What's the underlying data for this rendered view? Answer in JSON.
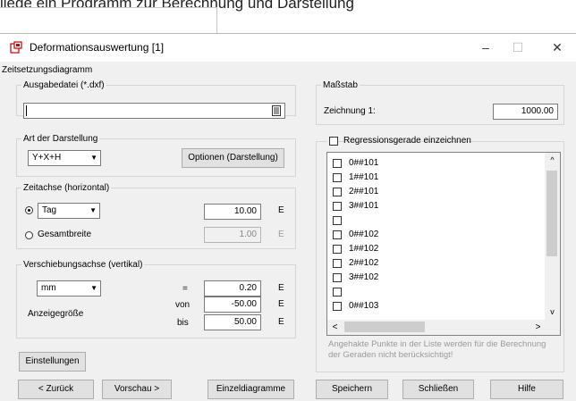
{
  "background": {
    "header_text": "liege ein Programm zur Berechnung und Darstellung"
  },
  "window": {
    "title": "Deformationsauswertung [1]",
    "controls": {
      "minimize": "–",
      "maximize": "☐",
      "close": "✕"
    },
    "subtitle": "Zeitsetzungsdiagramm"
  },
  "ausgabe": {
    "legend": "Ausgabedatei (*.dxf)",
    "value": ""
  },
  "massstab": {
    "legend": "Maßstab",
    "label": "Zeichnung 1:",
    "value": "1000.00"
  },
  "darstellung": {
    "legend": "Art der Darstellung",
    "mode": "Y+X+H",
    "options_button": "Optionen (Darstellung)"
  },
  "zeitachse": {
    "legend": "Zeitachse (horizontal)",
    "tag_unit": "Tag",
    "tag_value": "10.00",
    "tag_suffix": "E",
    "gesamt_label": "Gesamtbreite",
    "gesamt_value": "1.00",
    "gesamt_suffix": "E",
    "selected": "tag"
  },
  "verschiebung": {
    "legend": "Verschiebungsachse (vertikal)",
    "unit": "mm",
    "eq_label": "=",
    "eq_value": "0.20",
    "eq_suffix": "E",
    "von_label": "von",
    "von_value": "-50.00",
    "von_suffix": "E",
    "bis_label": "bis",
    "bis_value": "50.00",
    "bis_suffix": "E",
    "anzeige_label": "Anzeigegröße"
  },
  "regression": {
    "checkbox_label": "Regressionsgerade einzeichnen",
    "items": [
      "0##101",
      "1##101",
      "2##101",
      "3##101",
      "",
      "0##102",
      "1##102",
      "2##102",
      "3##102",
      "",
      "0##103"
    ],
    "hint": "Angehakte Punkte in der Liste werden für die Berechnung der Geraden nicht berücksichtigt!"
  },
  "buttons": {
    "einstellungen": "Einstellungen",
    "zurueck": "< Zurück",
    "vorschau": "Vorschau >",
    "einzeldiagramme": "Einzeldiagramme",
    "speichern": "Speichern",
    "schliessen": "Schließen",
    "hilfe": "Hilfe"
  }
}
